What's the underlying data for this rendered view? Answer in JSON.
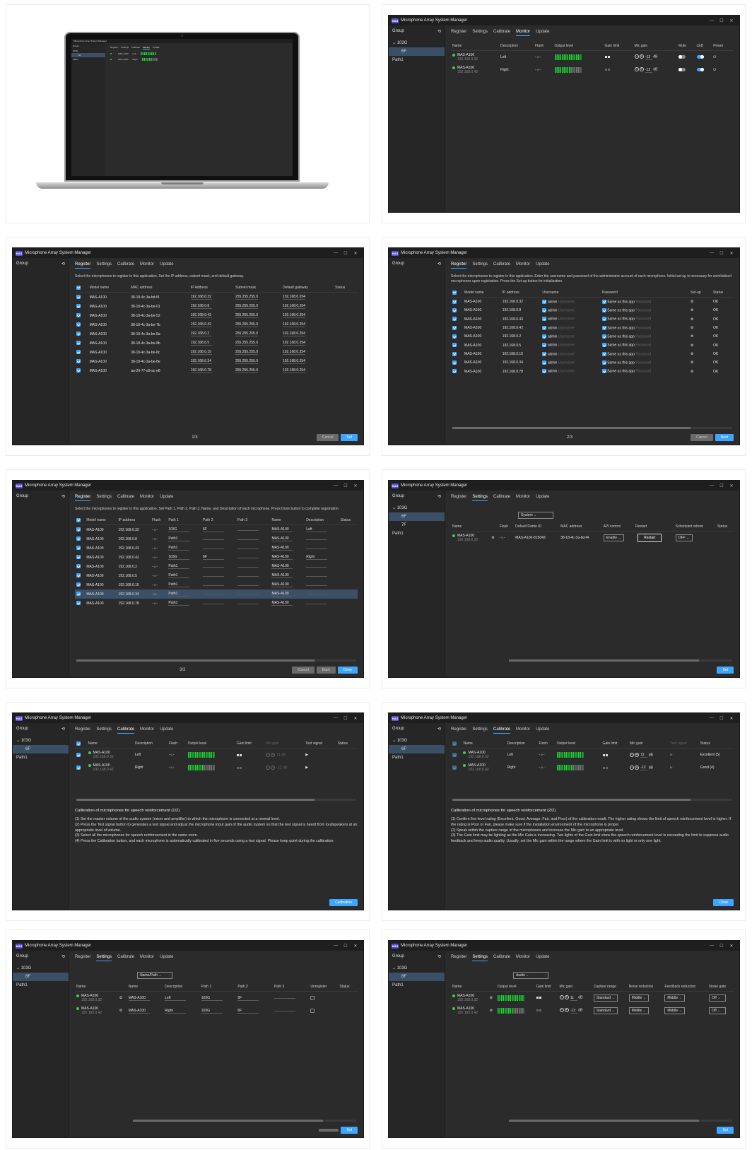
{
  "app": {
    "title": "Microphone Array System Manager",
    "logo": "MAS",
    "controls": [
      "—",
      "☐",
      "✕"
    ],
    "tabs": [
      "Register",
      "Settings",
      "Calibrate",
      "Monitor",
      "Update"
    ]
  },
  "sidebar": {
    "group_label": "Group",
    "refresh_icon": "refresh-icon",
    "items": [
      "103G",
      "6F",
      "Path1"
    ],
    "items_settings": [
      "103G",
      "6F",
      "7F",
      "Path1"
    ]
  },
  "monitor": {
    "headers": [
      "Name",
      "Description",
      "Flash",
      "Output level",
      "Gain limit",
      "Mic gain",
      "Mute",
      "LED",
      "Power"
    ],
    "rows": [
      {
        "name": "MAS-A100",
        "ip": "192.168.0.32",
        "desc": "Left",
        "gain": "-12",
        "unit": "dB"
      },
      {
        "name": "MAS-A100",
        "ip": "192.168.0.42",
        "desc": "Right",
        "gain": "-12",
        "unit": "dB"
      }
    ]
  },
  "register1": {
    "desc": "Select the microphones to register in this application. Set the IP address, subnet mask, and default gateway.",
    "headers": [
      "Model name",
      "MAC address",
      "IP Address",
      "Subnet mask",
      "Default gateway",
      "Status"
    ],
    "rows": [
      [
        "MAS-A100",
        "38-18-4c-3a-bd-f4",
        "192.168.0.32",
        "255.255.255.0",
        "192.168.0.254"
      ],
      [
        "MAS-A100",
        "38-18-4c-3a-be-01",
        "192.168.0.8",
        "255.255.255.0",
        "192.168.0.254"
      ],
      [
        "MAS-A100",
        "38-18-4c-3a-be-52",
        "192.168.0.43",
        "255.255.255.0",
        "192.168.0.254"
      ],
      [
        "MAS-A100",
        "38-18-4c-3a-be-7b",
        "192.168.0.42",
        "255.255.255.0",
        "192.168.0.254"
      ],
      [
        "MAS-A100",
        "38-18-4c-3a-be-8a",
        "192.168.0.2",
        "255.255.255.0",
        "192.168.0.254"
      ],
      [
        "MAS-A100",
        "38-18-4c-3a-be-8b",
        "192.168.0.5",
        "255.255.255.0",
        "192.168.0.254"
      ],
      [
        "MAS-A100",
        "38-18-4c-3a-be-8c",
        "192.168.0.15",
        "255.255.255.0",
        "192.168.0.254"
      ],
      [
        "MAS-A100",
        "38-18-4c-3a-be-8e",
        "192.168.0.34",
        "255.255.255.0",
        "192.168.0.254"
      ],
      [
        "MAS-A100",
        "aa-20-77-a9-ac-e8",
        "192.168.0.78",
        "255.255.255.0",
        "192.168.0.254"
      ]
    ],
    "pager": "1/3",
    "cancel": "Cancel",
    "set": "Set"
  },
  "register2": {
    "desc": "Select the microphones to register in this application. Enter the username and password of the administrator account of each microphone. Initial set-up is necessary for uninitialized microphones upon registration. Press the Set-up button for initialization.",
    "headers": [
      "Model name",
      "IP address",
      "Username",
      "Password",
      "Set-up",
      "Status"
    ],
    "ips": [
      "192.168.0.32",
      "192.168.0.8",
      "192.168.0.43",
      "192.168.0.42",
      "192.168.0.2",
      "192.168.0.5",
      "192.168.0.15",
      "192.168.0.34",
      "192.168.0.78"
    ],
    "model": "MAS-A100",
    "admin": "admin",
    "username_ph": "Username",
    "same": "Same as this app",
    "password_ph": "Password",
    "ok": "OK",
    "pager": "2/3",
    "cancel": "Cancel",
    "next": "Next"
  },
  "register3": {
    "desc": "Select the microphones to register in this application. Set Path 1, Path 2, Path 3, Name, and Description of each microphone. Press Done button to complete registration.",
    "headers": [
      "Model name",
      "IP address",
      "Flash",
      "Path 1",
      "Path 2",
      "Path 3",
      "Name",
      "Description",
      "Status"
    ],
    "rows": [
      [
        "192.168.0.32",
        "103G",
        "6F",
        "Left"
      ],
      [
        "192.168.0.8",
        "Path1",
        "",
        ""
      ],
      [
        "192.168.0.43",
        "Path1",
        "",
        ""
      ],
      [
        "192.168.0.42",
        "103G",
        "6F",
        "Right"
      ],
      [
        "192.168.0.2",
        "Path1",
        "",
        ""
      ],
      [
        "192.168.0.5",
        "Path1",
        "",
        ""
      ],
      [
        "192.168.0.15",
        "Path1",
        "",
        ""
      ],
      [
        "192.168.0.34",
        "Path1",
        "",
        ""
      ],
      [
        "192.168.0.78",
        "Path1",
        "",
        ""
      ]
    ],
    "pager": "3/3",
    "cancel": "Cancel",
    "back": "Back",
    "done": "Done"
  },
  "settings_system": {
    "dropdown": "System",
    "headers": [
      "Name",
      "Flash",
      "Default Dante ID",
      "MAC address",
      "API control",
      "Restart",
      "Scheduled reboot",
      "Status"
    ],
    "name": "MAS-A100",
    "ip": "192.168.0.32",
    "dante": "MAS-A100-815043",
    "mac": "38-18-4c-3a-bd-f4",
    "api": "Enable",
    "restart": "Restart",
    "reboot": "OFF",
    "set": "Set"
  },
  "calib1": {
    "headers": [
      "Name",
      "Description",
      "Flash",
      "Output level",
      "Gain limit",
      "Mic gain",
      "Test signal",
      "Status"
    ],
    "title": "Calibration of microphones for speech reinforcement (1/2)",
    "steps": [
      "(1) Set the master volume of the audio system (mixer and amplifier) to which the microphone is connected at a normal level.",
      "(2) Press the Test signal button to generates a test signal and adjust the microphone input gain of the audio system so that the test signal is heard from loudspeakers at an appropriate level of volume.",
      "(3) Select all the microphones for speech reinforcement in the same room.",
      "(4) Press the Calibration button, and each microphone is automatically calibrated in five seconds using a test signal. Please keep quiet during the calibration."
    ],
    "button": "Calibration",
    "gain1": "11",
    "gain2": "-12",
    "unit": "dB"
  },
  "calib2": {
    "title": "Calibration of microphones for speech reinforcement (2/2)",
    "steps": [
      "(1) Confirm five-level rating (Excellent, Good, Average, Fair, and Poor) of the calibration result. The higher rating shows the limit of speech reinforcement level is higher. If the rating is Poor or Fair, please make sure if the installation environment of the microphone is proper.",
      "(2) Speak within the capture range of the microphones and increase the Mic gain to an appropriate level.",
      "(3) The Gain limit may be lighting as the Mic Gain is increasing. Two lights of the Gain limit show the speech reinforcement level is exceeding the limit to suppress audio feedback and keep audio quality. Usually, set the Mic gain within the range where the Gain limit is with no light or only one light."
    ],
    "status1": "Excellent (5)",
    "status2": "Good (4)",
    "button": "Close"
  },
  "settings_name": {
    "dropdown": "Name/Path",
    "headers": [
      "Name",
      "Name",
      "Description",
      "Path 1",
      "Path 2",
      "Path 3",
      "Unregister",
      "Status"
    ],
    "rows": [
      {
        "name": "MAS-A100",
        "ip": "192.168.0.32",
        "desc": "Left",
        "p1": "103G",
        "p2": "6F"
      },
      {
        "name": "MAS-A100",
        "ip": "192.168.0.42",
        "desc": "Right",
        "p1": "103G",
        "p2": "6F"
      }
    ],
    "set": "Set"
  },
  "settings_audio": {
    "dropdown": "Audio",
    "headers": [
      "Name",
      "Output level",
      "Gain limit",
      "Mic gain",
      "Capture range",
      "Noise reduction",
      "Feedback reduction",
      "Noise gate"
    ],
    "rows": [
      {
        "name": "MAS-A100",
        "ip": "192.168.0.32",
        "gain": "11"
      },
      {
        "name": "MAS-A100",
        "ip": "192.168.0.42",
        "gain": "-12"
      }
    ],
    "unit": "dB",
    "capture": "Standard",
    "nr": "Middle",
    "fr": "Middle",
    "gate": "Off",
    "set": "Set"
  }
}
